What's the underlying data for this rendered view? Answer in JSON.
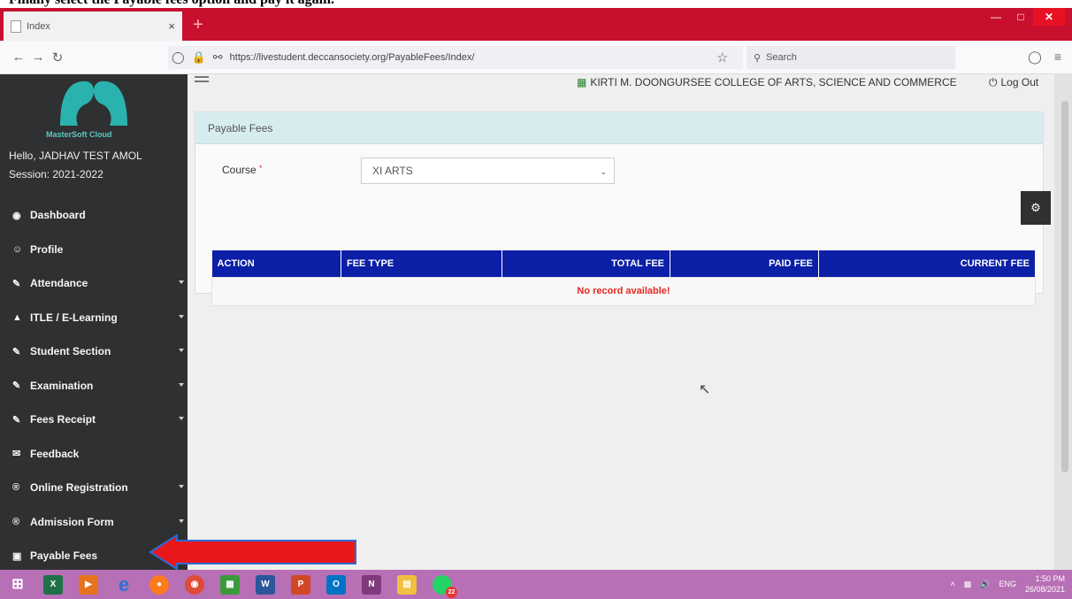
{
  "caption": "Finally select the Payable fees option and pay it again.",
  "browser": {
    "tab_title": "Index",
    "tab_close": "×",
    "new_tab": "+",
    "url": "https://livestudent.deccansociety.org/PayableFees/Index/",
    "search_placeholder": "Search"
  },
  "header": {
    "college": "KIRTI M. DOONGURSEE COLLEGE OF ARTS, SCIENCE AND COMMERCE",
    "logout": "Log Out"
  },
  "sidebar": {
    "logo_text": "MasterSoft Cloud",
    "greeting": "Hello, JADHAV TEST AMOL",
    "session": "Session: 2021-2022",
    "items": [
      {
        "label": "Dashboard",
        "icon": "dashboard-icon"
      },
      {
        "label": "Profile",
        "icon": "user-icon"
      },
      {
        "label": "Attendance",
        "icon": "pencil-icon"
      },
      {
        "label": "ITLE / E-Learning",
        "icon": "graduation-cap-icon"
      },
      {
        "label": "Student Section",
        "icon": "pencil-icon"
      },
      {
        "label": "Examination",
        "icon": "pencil-icon"
      },
      {
        "label": "Fees Receipt",
        "icon": "pencil-icon"
      },
      {
        "label": "Feedback",
        "icon": "comments-icon"
      },
      {
        "label": "Online Registration",
        "icon": "registered-icon"
      },
      {
        "label": "Admission Form",
        "icon": "registered-icon"
      },
      {
        "label": "Payable Fees",
        "icon": "money-icon"
      }
    ]
  },
  "panel": {
    "title": "Payable Fees",
    "course_label": "Course",
    "course_required": "*",
    "course_value": "XI ARTS"
  },
  "table": {
    "headers": [
      "ACTION",
      "FEE TYPE",
      "TOTAL FEE",
      "PAID FEE",
      "CURRENT FEE"
    ],
    "empty_message": "No record available!"
  },
  "taskbar": {
    "lang": "ENG",
    "time": "1:50 PM",
    "date": "26/08/2021",
    "whatsapp_badge": "22"
  },
  "colors": {
    "tab_bar": "#c8102e",
    "sidebar": "#2f3032",
    "table_header": "#0c1fa7",
    "panel_header": "#d7ecef",
    "empty_text": "#e4281f",
    "taskbar": "#b76fb6",
    "arrow": "#e8171c"
  }
}
